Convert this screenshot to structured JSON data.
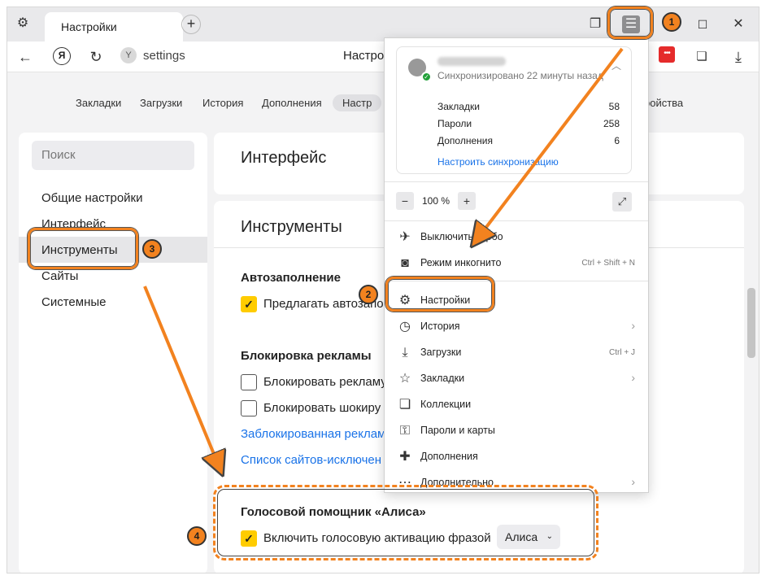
{
  "tabbar": {
    "tab_title": "Настройки",
    "new_tab": "+",
    "window_minimize": "–",
    "window_maximize": "☐",
    "window_close": "✕"
  },
  "addressbar": {
    "yandex_logo": "Я",
    "url": "settings",
    "page_title": "Настро",
    "ext_badge": "•••"
  },
  "settings_nav": [
    "Закладки",
    "Загрузки",
    "История",
    "Дополнения",
    "Настр",
    "ройства"
  ],
  "sidebar": {
    "search_placeholder": "Поиск",
    "items": [
      "Общие настройки",
      "Интерфейс",
      "Инструменты",
      "Сайты",
      "Системные"
    ]
  },
  "main": {
    "interface_title": "Интерфейс",
    "tools_title": "Инструменты",
    "autofill_title": "Автозаполнение",
    "autofill_option": "Предлагать автозапо",
    "adblock_title": "Блокировка рекламы",
    "adblock_option1": "Блокировать рекламу",
    "adblock_option2": "Блокировать шокиру",
    "blocked_link": "Заблокированная реклам",
    "exceptions_link": "Список сайтов-исключен",
    "alice_title": "Голосовой помощник «Алиса»",
    "alice_option": "Включить голосовую активацию фразой",
    "alice_select": "Алиса",
    "check_mark": "✓"
  },
  "menu": {
    "sync_status": "Синхронизировано 22 минуты назад",
    "stats": [
      {
        "label": "Закладки",
        "value": "58"
      },
      {
        "label": "Пароли",
        "value": "258"
      },
      {
        "label": "Дополнения",
        "value": "6"
      }
    ],
    "sync_link": "Настроить синхронизацию",
    "zoom": {
      "minus": "−",
      "value": "100 %",
      "plus": "+"
    },
    "items": [
      {
        "label": "Выключить турбо",
        "icon": "turbo-off-icon",
        "shortcut": ""
      },
      {
        "label": "Режим инкогнито",
        "icon": "incognito-icon",
        "shortcut": "Ctrl + Shift + N"
      },
      {
        "label": "Настройки",
        "icon": "gear-icon",
        "shortcut": ""
      },
      {
        "label": "История",
        "icon": "history-icon",
        "shortcut": ""
      },
      {
        "label": "Загрузки",
        "icon": "download-icon",
        "shortcut": "Ctrl + J"
      },
      {
        "label": "Закладки",
        "icon": "star-icon",
        "shortcut": ""
      },
      {
        "label": "Коллекции",
        "icon": "collections-icon",
        "shortcut": ""
      },
      {
        "label": "Пароли и карты",
        "icon": "key-icon",
        "shortcut": ""
      },
      {
        "label": "Дополнения",
        "icon": "puzzle-icon",
        "shortcut": ""
      },
      {
        "label": "Дополнительно",
        "icon": "more-icon",
        "shortcut": ""
      }
    ]
  },
  "annotations": {
    "badge1": "1",
    "badge2": "2",
    "badge3": "3",
    "badge4": "4"
  },
  "colors": {
    "accent": "#ffcc00",
    "annotation": "#f2821f",
    "link": "#1a73e8"
  }
}
